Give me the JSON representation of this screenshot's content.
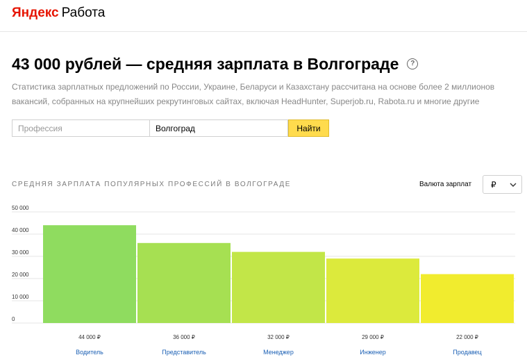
{
  "header": {
    "brand": "Яндекс",
    "service": "Работа"
  },
  "page": {
    "title": "43 000 рублей — средняя зарплата в Волгограде",
    "help_icon": "?",
    "description": "Статистика зарплатных предложений по России, Украине, Беларуси и Казахстану рассчитана на основе более 2 миллионов вакансий, собранных на крупнейших рекрутинговых сайтах, включая HeadHunter, Superjob.ru, Rabota.ru и многие другие"
  },
  "search": {
    "profession_placeholder": "Профессия",
    "profession_value": "",
    "city_value": "Волгоград",
    "button_label": "Найти"
  },
  "currency": {
    "label": "Валюта зарплат",
    "selected": "₽",
    "chevron_icon": "chevron-down-icon"
  },
  "colors": {
    "accent_button": "#ffdb4d",
    "link": "#1a5fb4",
    "logo_red": "#e61400"
  },
  "chart_data": {
    "type": "bar",
    "title": "Средняя зарплата популярных профессий в Волгограде",
    "categories": [
      "Водитель",
      "Представитель",
      "Менеджер",
      "Инженер",
      "Продавец"
    ],
    "values": [
      44000,
      36000,
      32000,
      29000,
      22000
    ],
    "value_labels": [
      "44 000 ₽",
      "36 000 ₽",
      "32 000 ₽",
      "29 000 ₽",
      "22 000 ₽"
    ],
    "bar_colors": [
      "#8fdc5f",
      "#a6e052",
      "#c2e648",
      "#dcea3c",
      "#f1ec2e"
    ],
    "yticks": [
      0,
      10000,
      20000,
      30000,
      40000,
      50000
    ],
    "ytick_labels": [
      "0",
      "10 000",
      "20 000",
      "30 000",
      "40 000",
      "50 000"
    ],
    "ylim": [
      0,
      50000
    ],
    "grid": true,
    "xlabel": "",
    "ylabel": ""
  }
}
